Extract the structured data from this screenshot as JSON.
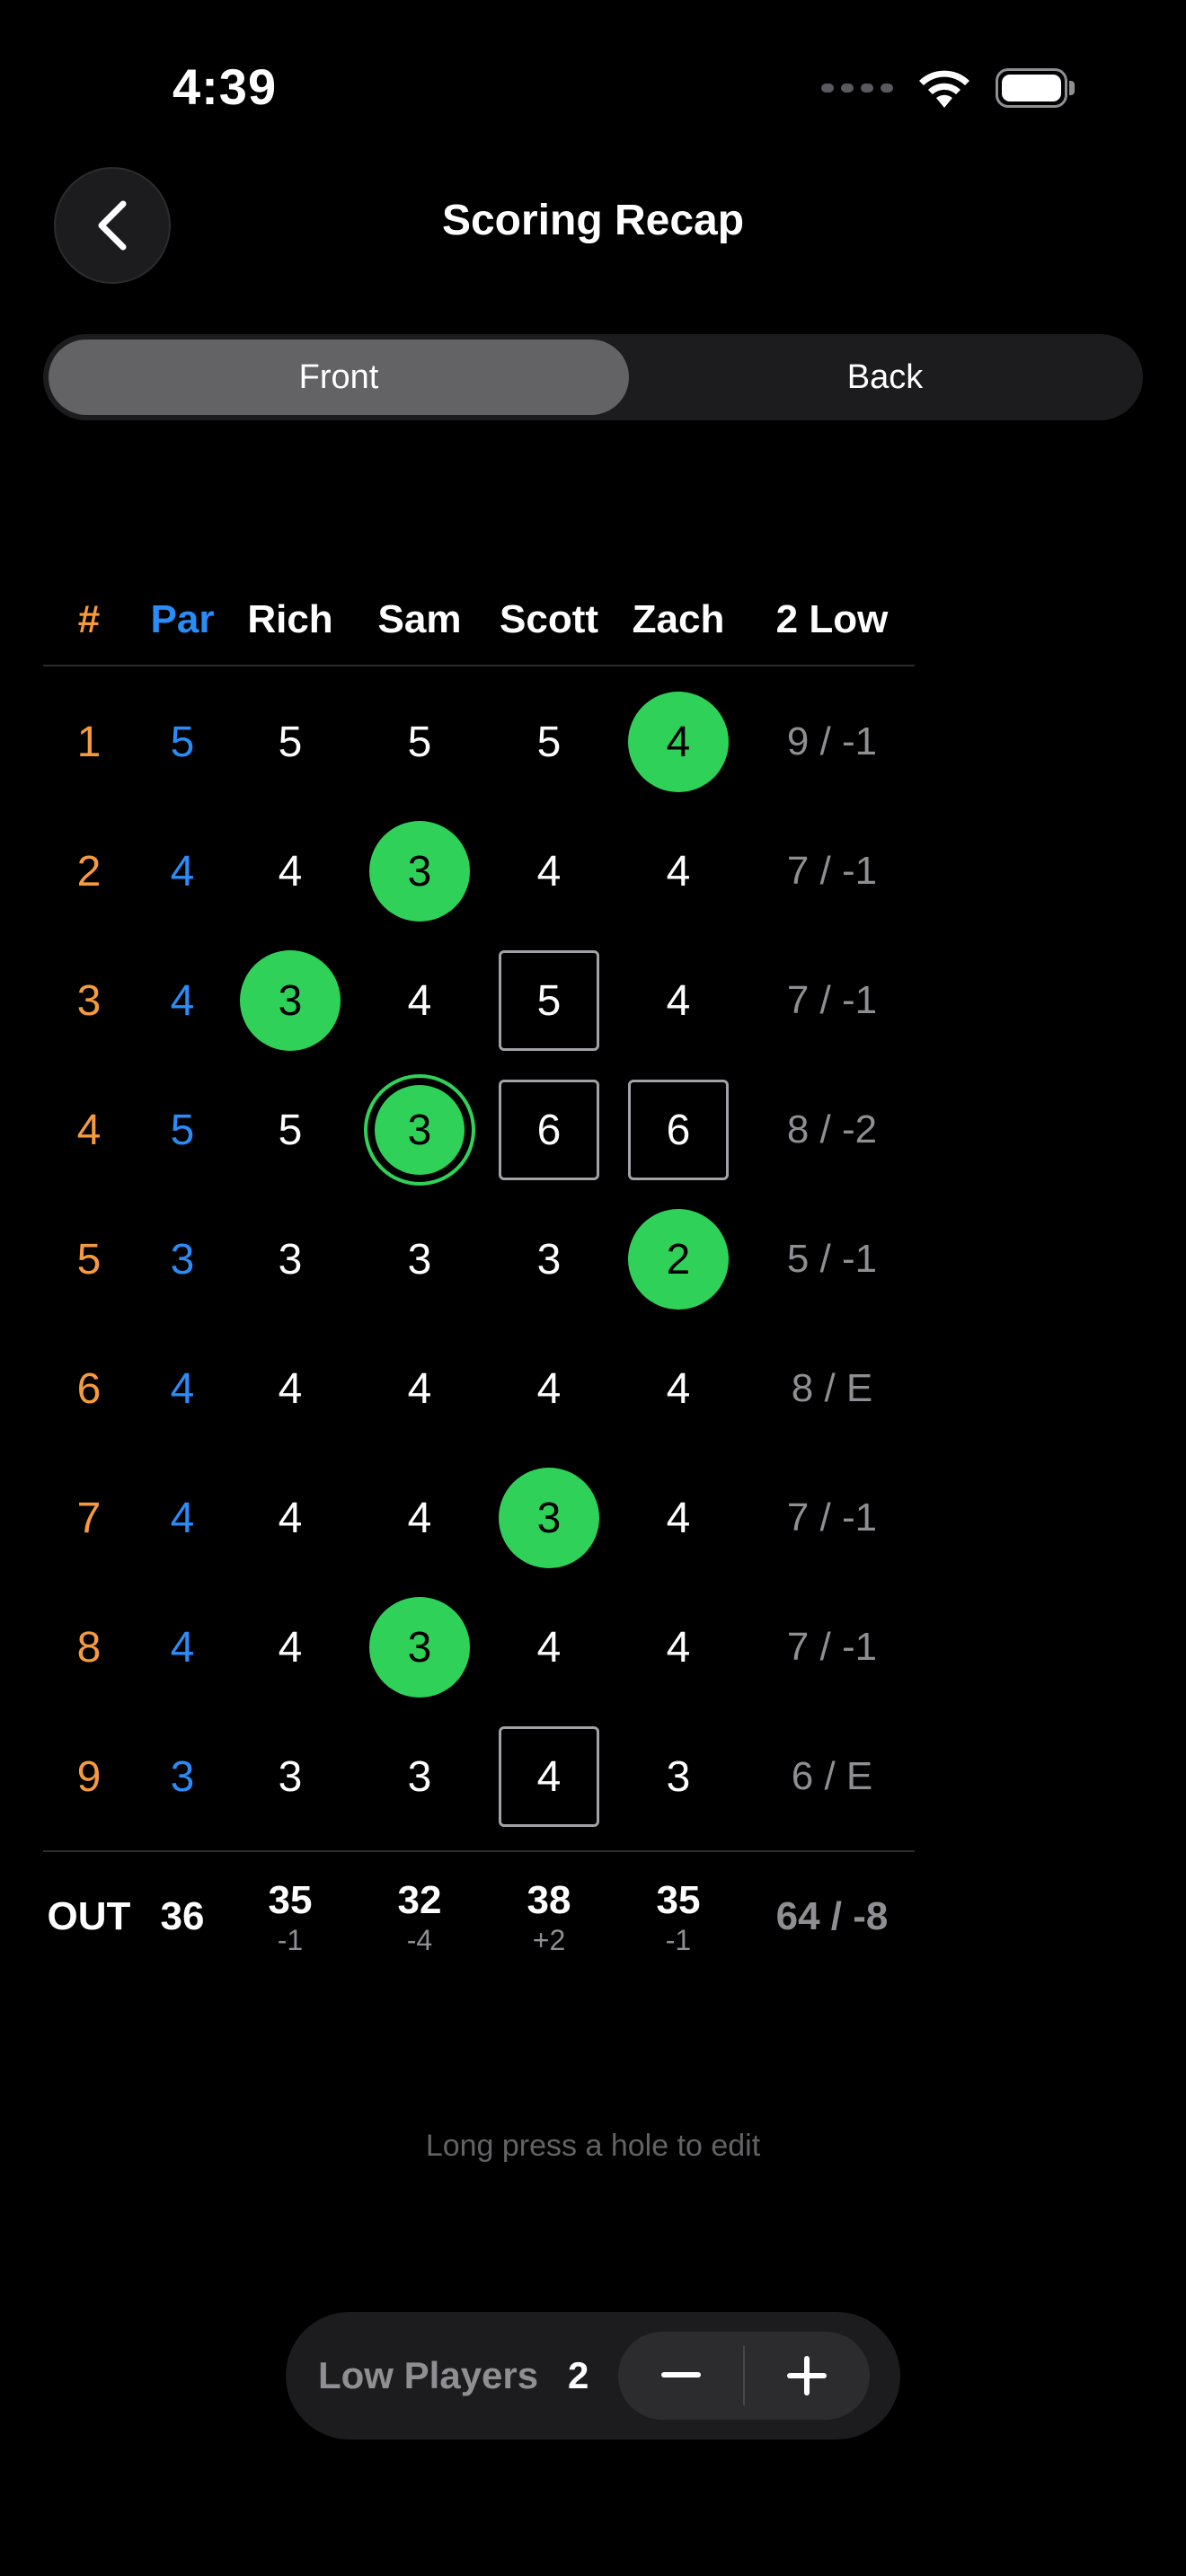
{
  "status": {
    "time": "4:39"
  },
  "nav": {
    "title": "Scoring Recap"
  },
  "segments": {
    "front": "Front",
    "back": "Back",
    "selected": "Front"
  },
  "table": {
    "headers": {
      "hole": "#",
      "par": "Par",
      "players": [
        "Rich",
        "Sam",
        "Scott",
        "Zach"
      ],
      "low": "2 Low"
    },
    "rows": [
      {
        "hole": "1",
        "par": "5",
        "scores": [
          "5",
          "5",
          "5",
          "4"
        ],
        "marks": [
          "",
          "",
          "",
          "circle"
        ],
        "low": "9 / -1"
      },
      {
        "hole": "2",
        "par": "4",
        "scores": [
          "4",
          "3",
          "4",
          "4"
        ],
        "marks": [
          "",
          "circle",
          "",
          ""
        ],
        "low": "7 / -1"
      },
      {
        "hole": "3",
        "par": "4",
        "scores": [
          "3",
          "4",
          "5",
          "4"
        ],
        "marks": [
          "circle",
          "",
          "square",
          ""
        ],
        "low": "7 / -1"
      },
      {
        "hole": "4",
        "par": "5",
        "scores": [
          "5",
          "3",
          "6",
          "6"
        ],
        "marks": [
          "",
          "double-circle",
          "square",
          "square"
        ],
        "low": "8 / -2"
      },
      {
        "hole": "5",
        "par": "3",
        "scores": [
          "3",
          "3",
          "3",
          "2"
        ],
        "marks": [
          "",
          "",
          "",
          "circle"
        ],
        "low": "5 / -1"
      },
      {
        "hole": "6",
        "par": "4",
        "scores": [
          "4",
          "4",
          "4",
          "4"
        ],
        "marks": [
          "",
          "",
          "",
          ""
        ],
        "low": "8 / E"
      },
      {
        "hole": "7",
        "par": "4",
        "scores": [
          "4",
          "4",
          "3",
          "4"
        ],
        "marks": [
          "",
          "",
          "circle",
          ""
        ],
        "low": "7 / -1"
      },
      {
        "hole": "8",
        "par": "4",
        "scores": [
          "4",
          "3",
          "4",
          "4"
        ],
        "marks": [
          "",
          "circle",
          "",
          ""
        ],
        "low": "7 / -1"
      },
      {
        "hole": "9",
        "par": "3",
        "scores": [
          "3",
          "3",
          "4",
          "3"
        ],
        "marks": [
          "",
          "",
          "square",
          ""
        ],
        "low": "6 / E"
      }
    ],
    "totals": {
      "label": "OUT",
      "par": "36",
      "players": [
        {
          "total": "35",
          "diff": "-1"
        },
        {
          "total": "32",
          "diff": "-4"
        },
        {
          "total": "38",
          "diff": "+2"
        },
        {
          "total": "35",
          "diff": "-1"
        }
      ],
      "low": "64 / -8"
    }
  },
  "hint": "Long press a hole to edit",
  "low_players": {
    "label": "Low Players",
    "value": "2"
  },
  "colors": {
    "hole": "#f79a3e",
    "par": "#2a8cf7",
    "birdie": "#30d158",
    "muted": "#8e8e93"
  }
}
